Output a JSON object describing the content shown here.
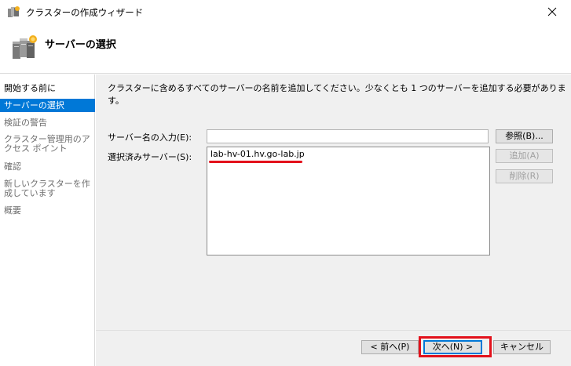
{
  "window": {
    "title": "クラスターの作成ウィザード"
  },
  "header": {
    "title": "サーバーの選択"
  },
  "sidebar": {
    "items": [
      {
        "label": "開始する前に"
      },
      {
        "label": "サーバーの選択"
      },
      {
        "label": "検証の警告"
      },
      {
        "label": "クラスター管理用のアクセス ポイント"
      },
      {
        "label": "確認"
      },
      {
        "label": "新しいクラスターを作成しています"
      },
      {
        "label": "概要"
      }
    ],
    "selected_index": 1
  },
  "main": {
    "instruction": "クラスターに含めるすべてのサーバーの名前を追加してください。少なくとも 1 つのサーバーを追加する必要があります。",
    "server_name_label": "サーバー名の入力(E):",
    "server_name_value": "",
    "selected_servers_label": "選択済みサーバー(S):",
    "selected_servers": [
      "lab-hv-01.hv.go-lab.jp"
    ],
    "browse_button": "参照(B)...",
    "add_button": "追加(A)",
    "remove_button": "削除(R)"
  },
  "footer": {
    "back_button": "< 前へ(P)",
    "next_button": "次へ(N) >",
    "cancel_button": "キャンセル"
  },
  "colors": {
    "selection": "#0078d7",
    "annotation": "#e3111b",
    "panel": "#f0f0f0"
  }
}
